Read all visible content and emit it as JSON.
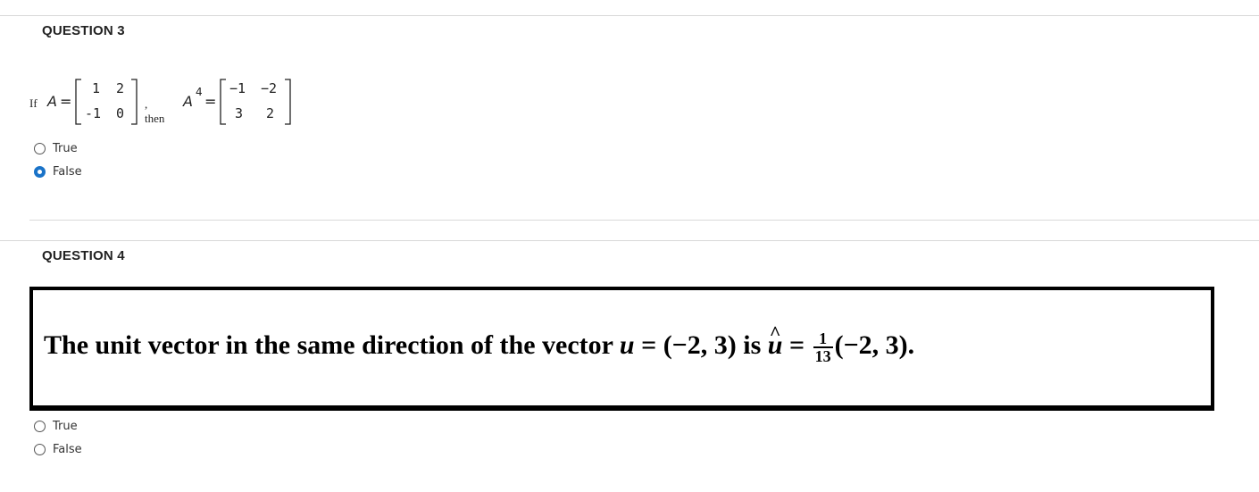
{
  "questions": [
    {
      "title": "QUESTION 3",
      "prompt": {
        "if": "If",
        "a_label": "A",
        "equals": "=",
        "matrix_a": [
          [
            "1",
            "2"
          ],
          [
            "-1",
            "0"
          ]
        ],
        "then": ", then",
        "a4_label": "A",
        "a4_exp": "4",
        "equals2": "=",
        "matrix_a4": [
          [
            "−1",
            "−2"
          ],
          [
            "3",
            "2"
          ]
        ]
      },
      "options": [
        {
          "label": "True",
          "selected": false
        },
        {
          "label": "False",
          "selected": true
        }
      ]
    },
    {
      "title": "QUESTION 4",
      "statement": {
        "text_before": "The unit vector in the same direction of the vector ",
        "u": "u",
        "eq_part": " = (−2, 3) is ",
        "uhat": "u",
        "hat": "^",
        "eq2": " = ",
        "frac_num": "1",
        "frac_den": "13",
        "tail": "(−2, 3)."
      },
      "options": [
        {
          "label": "True",
          "selected": false
        },
        {
          "label": "False",
          "selected": false
        }
      ]
    }
  ]
}
